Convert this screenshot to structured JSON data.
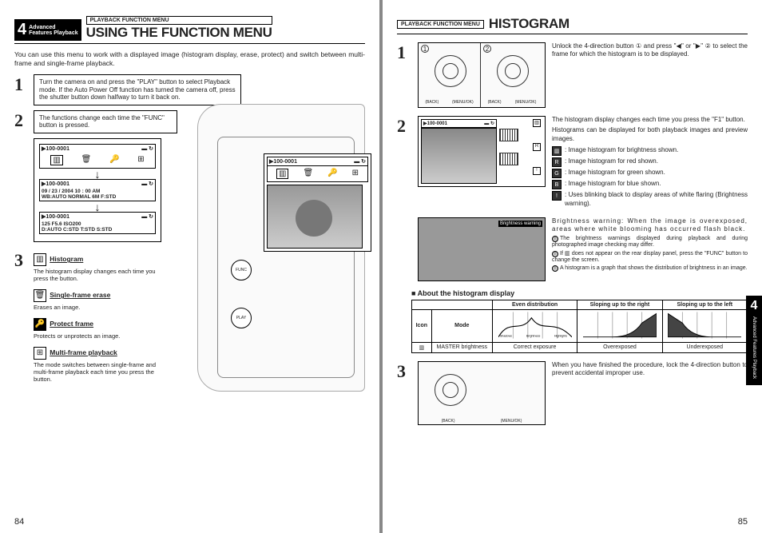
{
  "left": {
    "chapter_num": "4",
    "chapter_text1": "Advanced",
    "chapter_text2": "Features Playback",
    "menu_tag": "PLAYBACK FUNCTION MENU",
    "title": "USING THE FUNCTION MENU",
    "intro": "You can use this menu to work with a displayed image (histogram display, erase, protect) and switch between multi-frame and single-frame playback.",
    "step1": "Turn the camera on and press the \"PLAY\" button to select Playback mode. If the Auto Power Off function has turned the camera off, press the shutter button down halfway to turn it back on.",
    "step2": "The functions change each time the \"FUNC\" button is pressed.",
    "lcd": {
      "file": "100-0001",
      "info2_line1": "09 / 23 / 2004   10 : 00 AM",
      "info2_line2": "WB:AUTO NORMAL 6M F:STD",
      "info3_line1": "125  F5.6   ISO200",
      "info3_line2": "D:AUTO C:STD T:STD S:STD"
    },
    "camera_lcd_file": "100-0001",
    "func_btn": "FUNC",
    "play_btn": "PLAY",
    "functions": [
      {
        "icon": "▥",
        "title": "Histogram",
        "desc": "The histogram display changes each time you press the button."
      },
      {
        "icon": "🗑",
        "title": "Single-frame erase",
        "desc": "Erases an image."
      },
      {
        "icon": "🔑",
        "title": "Protect frame",
        "desc": "Protects or unprotects an image."
      },
      {
        "icon": "⊞",
        "title": "Multi-frame playback",
        "desc": "The mode switches between single-frame and multi-frame playback each time you press the button."
      }
    ],
    "page_num": "84"
  },
  "right": {
    "menu_tag": "PLAYBACK FUNCTION MENU",
    "title": "HISTOGRAM",
    "step1_text": "Unlock the 4-direction button ① and press \"◀\" or \"▶\" ② to select the frame for which the histogram is to be displayed.",
    "step2_text1": "The histogram display changes each time you press the \"F1\" button.",
    "step2_text2": "Histograms can be displayed for both playback images and preview images.",
    "icon_defs": [
      ": Image histogram for brightness shown.",
      ": Image histogram for red shown.",
      ": Image histogram for green shown.",
      ": Image histogram for blue shown.",
      ": Uses blinking black to display areas of white flaring (Brightness warning)."
    ],
    "warn_title": "Brightness warning:",
    "warn_text": "When the image is overexposed, areas where white blooming has occurred flash black.",
    "warn_label": "Brightness warning",
    "notes": [
      "The brightness warnings displayed during playback and during photographed image checking may differ.",
      "If ▥ does not appear on the rear display panel, press the \"FUNC\" button to change the screen.",
      "A histogram is a graph that shows the distribution of brightness in an image."
    ],
    "about_title": "About the histogram display",
    "table": {
      "headers": [
        "",
        "Even distribution",
        "Sloping up to the right",
        "Sloping up to the left"
      ],
      "row_header": [
        "Icon",
        "Mode"
      ],
      "mode": "MASTER brightness",
      "labels_y": "number of pixels",
      "labels_x": [
        "Shadows",
        "Brightness",
        "Highlights"
      ],
      "verdicts": [
        "Correct exposure",
        "Overexposed",
        "Underexposed"
      ]
    },
    "step3_text": "When you have finished the procedure, lock the 4-direction button to prevent accidental improper use.",
    "dpad_back": "(BACK)",
    "dpad_menu": "(MENU/OK)",
    "side_tab_num": "4",
    "side_tab_text": "Advanced Features Playback",
    "page_num": "85",
    "lcd_file": "100-0001"
  }
}
